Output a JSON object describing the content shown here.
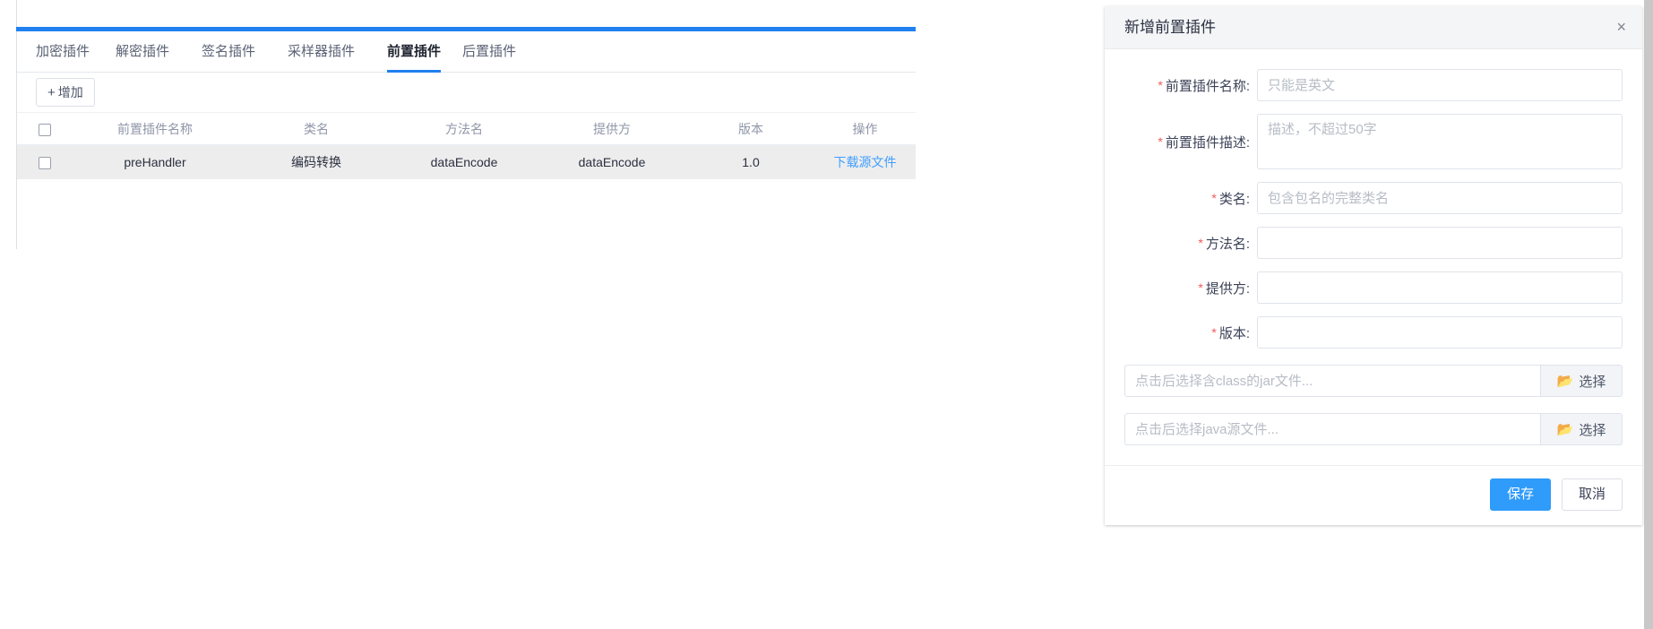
{
  "tabs": [
    {
      "label": "加密插件",
      "active": false
    },
    {
      "label": "解密插件",
      "active": false
    },
    {
      "label": "签名插件",
      "active": false
    },
    {
      "label": "采样器插件",
      "active": false
    },
    {
      "label": "前置插件",
      "active": true
    },
    {
      "label": "后置插件",
      "active": false
    }
  ],
  "toolbar": {
    "add_label": "增加",
    "add_icon": "plus-icon"
  },
  "table": {
    "columns": [
      "前置插件名称",
      "类名",
      "方法名",
      "提供方",
      "版本",
      "操作"
    ],
    "rows": [
      {
        "name": "preHandler",
        "class_name": "编码转换",
        "method": "dataEncode",
        "provider": "dataEncode",
        "version": "1.0",
        "action": "下载源文件"
      }
    ]
  },
  "dialog": {
    "title": "新增前置插件",
    "close_label": "×",
    "fields": [
      {
        "label": "前置插件名称:",
        "placeholder": "只能是英文",
        "value": "",
        "required": true,
        "type": "text"
      },
      {
        "label": "前置插件描述:",
        "placeholder": "描述，不超过50字",
        "value": "",
        "required": true,
        "type": "textarea"
      },
      {
        "label": "类名:",
        "placeholder": "包含包名的完整类名",
        "value": "",
        "required": true,
        "type": "text"
      },
      {
        "label": "方法名:",
        "placeholder": "",
        "value": "",
        "required": true,
        "type": "text"
      },
      {
        "label": "提供方:",
        "placeholder": "",
        "value": "",
        "required": true,
        "type": "text"
      },
      {
        "label": "版本:",
        "placeholder": "",
        "value": "",
        "required": true,
        "type": "text"
      }
    ],
    "file_pickers": [
      {
        "placeholder": "点击后选择含class的jar文件...",
        "value": "",
        "button_label": "选择",
        "icon": "folder-icon"
      },
      {
        "placeholder": "点击后选择java源文件...",
        "value": "",
        "button_label": "选择",
        "icon": "folder-icon"
      }
    ],
    "footer": {
      "save_label": "保存",
      "cancel_label": "取消"
    }
  },
  "colors": {
    "accent": "#2080f0",
    "primary_button": "#2f9bfa",
    "link": "#409eff",
    "required_star": "#f25a5a",
    "row_highlight": "#ededed"
  }
}
